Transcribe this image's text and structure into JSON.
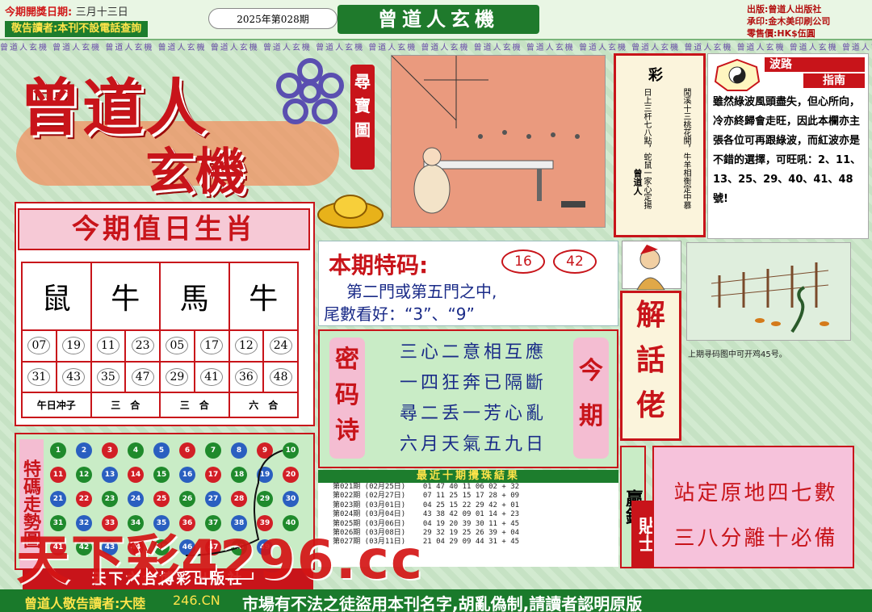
{
  "header": {
    "draw_date_label": "今期開獎日期:",
    "draw_date_value": "三月十三日",
    "notice": "敬告讀者:本刊不設電話查詢",
    "issue": "2025年第028期",
    "banner": "曾道人玄機",
    "publisher": "出版:曾道人出版社",
    "printer": "承印:金木美印刷公司",
    "price": "零售價:HK$伍圓"
  },
  "strip_text": "曾道人玄機",
  "logo": {
    "line1": "曾道人",
    "line2": "玄機"
  },
  "treasure_tab": "尋寶圖",
  "caishen": {
    "title": "彩",
    "verse1": "閒溪十三桃花開，牛羊相衡定中慕",
    "verse2": "日上三杆七八點，蛇鼠一家心定揚",
    "signature": "曾道人"
  },
  "bolu": {
    "title1": "波路",
    "title2": "指南",
    "body": "雖然綠波風頭盡失，但心所向，冷亦終歸會走旺，因此本欄亦主張各位可再跟綠波，而紅波亦是不錯的選擇，可旺吼：2、11、13、25、29、40、41、48號!"
  },
  "zodiac": {
    "title": "今期值日生肖",
    "columns": [
      {
        "icon": "rat-icon",
        "glyph": "鼠",
        "nums": [
          "07",
          "19",
          "31",
          "43"
        ],
        "caption": "午日冲子"
      },
      {
        "icon": "ox-icon",
        "glyph": "牛",
        "nums": [
          "11",
          "23",
          "35",
          "47"
        ],
        "caption": "三　合"
      },
      {
        "icon": "horse-icon",
        "glyph": "馬",
        "nums": [
          "05",
          "17",
          "29",
          "41"
        ],
        "caption": "三　合"
      },
      {
        "icon": "ox-icon",
        "glyph": "牛",
        "nums": [
          "12",
          "24",
          "36",
          "48"
        ],
        "caption": "六　合"
      }
    ]
  },
  "special": {
    "title": "本期特码:",
    "nums": [
      "16",
      "42"
    ],
    "line1": "第二門或第五門之中,",
    "line2": "尾數看好：“3”、“9”"
  },
  "poem": {
    "left": "密码诗",
    "right": "今期",
    "lines": [
      "三心二意相互應",
      "一四狂奔已隔斷",
      "尋二丢一芳心亂",
      "六月天氣五九日"
    ]
  },
  "results": {
    "title": "最近十期攪珠結果",
    "rows": [
      "第021期 (02月25日)    01 47 40 11 06 02 + 32",
      "第022期 (02月27日)    07 11 25 15 17 28 + 09",
      "第023期 (03月01日)    04 25 15 22 29 42 + 01",
      "第024期 (03月04日)    43 38 42 09 01 14 + 23",
      "第025期 (03月06日)    04 19 20 39 30 11 + 45",
      "第026期 (03月08日)    29 32 19 25 26 39 + 04",
      "第027期 (03月11日)    21 04 29 09 44 31 + 45"
    ]
  },
  "trend": {
    "label": "特碼走勢圖",
    "rows": [
      [
        "1",
        "2",
        "3",
        "4",
        "5",
        "6",
        "7",
        "8",
        "9",
        "10"
      ],
      [
        "11",
        "12",
        "13",
        "14",
        "15",
        "16",
        "17",
        "18",
        "19",
        "20"
      ],
      [
        "21",
        "22",
        "23",
        "24",
        "25",
        "26",
        "27",
        "28",
        "29",
        "30"
      ],
      [
        "31",
        "32",
        "33",
        "34",
        "35",
        "36",
        "37",
        "38",
        "39",
        "40"
      ],
      [
        "41",
        "42",
        "43",
        "44",
        "45",
        "46",
        "47",
        "48",
        "49",
        ""
      ]
    ]
  },
  "jie": "解話佬",
  "last_caption": "上期寻码图中可开鸡45号。",
  "yingqian": "贏錢",
  "tieshi": "貼士",
  "fourseven": {
    "line1": "站定原地四七數",
    "line2": "三八分離十必備"
  },
  "publisher_bar": "天下六合博彩出版社",
  "watermark": "天下彩4296.cc",
  "bottom": {
    "prefix": "曾道人敬告讀者:大陸",
    "domain": "246.CN",
    "text": "市場有不法之徒盜用本刊名字,胡亂偽制,請讀者認明原版"
  },
  "colors": {
    "red": "#c8141a",
    "green": "#1d7d2d",
    "pink": "#f4bdd2"
  }
}
